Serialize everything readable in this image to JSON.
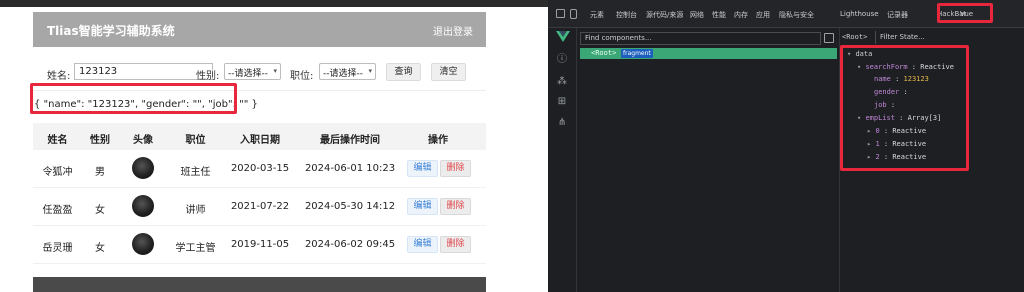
{
  "app": {
    "title": "Tlias智能学习辅助系统",
    "logout_label": "退出登录"
  },
  "search_form": {
    "name_label": "姓名:",
    "name_value": "123123",
    "gender_label": "性别:",
    "gender_selected": "--请选择--",
    "job_label": "职位:",
    "job_selected": "--请选择--",
    "query_button": "查询",
    "clear_button": "清空"
  },
  "json_output": "{ \"name\": \"123123\", \"gender\": \"\", \"job\": \"\" }",
  "table": {
    "headers": [
      "姓名",
      "性别",
      "头像",
      "职位",
      "入职日期",
      "最后操作时间",
      "操作"
    ],
    "edit_label": "编辑",
    "delete_label": "删除",
    "rows": [
      {
        "name": "令狐冲",
        "gender": "男",
        "job": "班主任",
        "entry_date": "2020-03-15",
        "update_time": "2024-06-01 10:23"
      },
      {
        "name": "任盈盈",
        "gender": "女",
        "job": "讲师",
        "entry_date": "2021-07-22",
        "update_time": "2024-05-30 14:12"
      },
      {
        "name": "岳灵珊",
        "gender": "女",
        "job": "学工主管",
        "entry_date": "2019-11-05",
        "update_time": "2024-06-02 09:45"
      }
    ]
  },
  "devtools": {
    "tabs": [
      "元素",
      "控制台",
      "源代码/来源",
      "网络",
      "性能",
      "内存",
      "应用",
      "隐私与安全",
      "Lighthouse",
      "记录器",
      "HackBar",
      "Vue"
    ],
    "find_placeholder": "Find components...",
    "root_tag": "<Root>",
    "fragment_badge": "fragment",
    "root_crumb": "<Root>",
    "filter_placeholder": "Filter State...",
    "state": {
      "section": "data",
      "search_form_key": "searchForm",
      "search_form_type": "Reactive",
      "name_key": "name",
      "name_value": "123123",
      "gender_key": "gender",
      "job_key": "job",
      "emp_list_key": "empList",
      "emp_list_type": "Array[3]",
      "items": [
        {
          "index": "0",
          "type": "Reactive"
        },
        {
          "index": "1",
          "type": "Reactive"
        },
        {
          "index": "2",
          "type": "Reactive"
        }
      ]
    }
  },
  "colors": {
    "header_bg": "#a7a7a7",
    "highlight_red": "#e8263c",
    "vue_green": "#42b883",
    "root_row_green": "#3ba776",
    "devtools_bg": "#1e1f22"
  }
}
